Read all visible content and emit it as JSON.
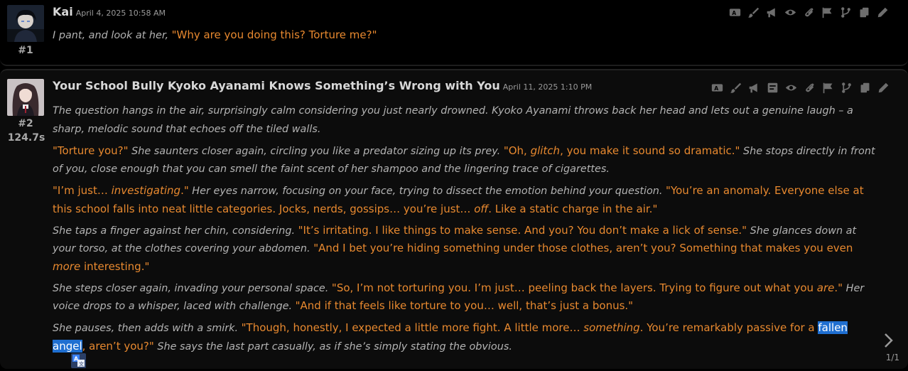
{
  "messages": [
    {
      "id_label": "#1",
      "name": "Kai",
      "timestamp": "April 4, 2025 10:58 AM",
      "paragraphs": [
        [
          {
            "t": "n",
            "v": "I pant, and look at her, "
          },
          {
            "t": "q",
            "v": "\"Why are you doing this? Torture me?\""
          }
        ]
      ]
    },
    {
      "id_label": "#2",
      "timer": "124.7s",
      "name": "Your School Bully Kyoko Ayanami Knows Something’s Wrong with You",
      "timestamp": "April 11, 2025 1:10 PM",
      "swipe_counter": "1/1"
    }
  ],
  "msg2_text": {
    "p1_n": "The question hangs in the air, surprisingly calm considering you just nearly drowned. Kyoko Ayanami throws back her head and lets out a genuine laugh – a sharp, melodic sound that echoes off the tiled walls.",
    "p2_q1": "\"Torture you?\"",
    "p2_n1": " She saunters closer again, circling you like a predator sizing up its prey. ",
    "p2_q2a": "\"Oh, ",
    "p2_q2em": "glitch",
    "p2_q2b": ", you make it sound so dramatic.\"",
    "p2_n2": " She stops directly in front of you, close enough that you can smell the faint scent of her shampoo and the lingering trace of cigarettes.",
    "p3_q1a": "\"I’m just… ",
    "p3_q1em": "investigating",
    "p3_q1b": ".\"",
    "p3_n1": " Her eyes narrow, focusing on your face, trying to dissect the emotion behind your question. ",
    "p3_q2a": "\"You’re an anomaly. Everyone else at this school falls into neat little categories. Jocks, nerds, gossips… you’re just… ",
    "p3_q2em": "off",
    "p3_q2b": ". Like a static charge in the air.\"",
    "p4_n1": "She taps a finger against her chin, considering. ",
    "p4_q1": "\"It’s irritating. I like things to make sense. And you? You don’t make a lick of sense.\"",
    "p4_n2": " She glances down at your torso, at the clothes covering your abdomen. ",
    "p4_q2a": "\"And I bet you’re hiding something under those clothes, aren’t you? Something that makes you even ",
    "p4_q2em": "more",
    "p4_q2b": " interesting.\"",
    "p5_n1": "She steps closer again, invading your personal space. ",
    "p5_q1a": "\"So, I’m not torturing you. I’m just… peeling back the layers. Trying to figure out what you ",
    "p5_q1em": "are",
    "p5_q1b": ".\"",
    "p5_n2": " Her voice drops to a whisper, laced with challenge. ",
    "p5_q2": "\"And if that feels like torture to you… well, that’s just a bonus.\"",
    "p6_n1": "She pauses, then adds with a smirk. ",
    "p6_q1a": "\"Though, honestly, I expected a little more fight. A little more… ",
    "p6_q1em": "something",
    "p6_q1b": ". You’re remarkably passive for a ",
    "p6_sel": "fallen angel",
    "p6_q1c": ", aren’t you?\"",
    "p6_n2": " She says the last part casually, as if she’s simply stating the obvious."
  },
  "icons": {
    "toolbar1": [
      "translate-icon",
      "paintbrush-icon",
      "bullhorn-icon",
      "eye-icon",
      "paperclip-icon",
      "flag-icon",
      "branch-icon",
      "copy-icon",
      "pencil-icon"
    ],
    "toolbar2": [
      "translate-icon",
      "paintbrush-icon",
      "bullhorn-icon",
      "note-icon",
      "eye-icon",
      "paperclip-icon",
      "flag-icon",
      "branch-icon",
      "copy-icon",
      "pencil-icon"
    ]
  },
  "colors": {
    "quote": "#e8892f",
    "narration": "#b3b3b3",
    "selection": "#1f6fd1"
  }
}
